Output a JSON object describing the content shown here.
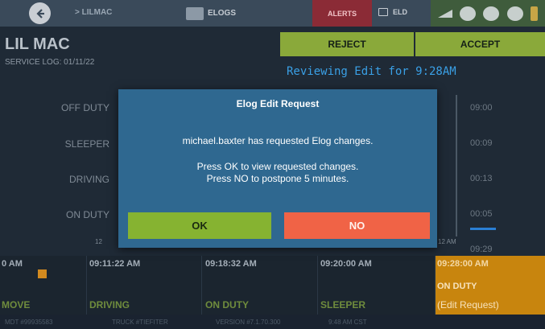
{
  "topbar": {
    "back_icon": "back-arrow-icon",
    "vehicle": "> LILMAC",
    "elogs_tab": "ELOGS",
    "alerts_tab": "ALERTS",
    "eld_tab": "ELD",
    "status_icons": [
      "signal-icon",
      "globe-icon",
      "truck-icon",
      "gauge-icon",
      "battery-icon"
    ]
  },
  "header": {
    "title": "LIL MAC",
    "service_log": "SERVICE LOG: 01/11/22",
    "reject_label": "REJECT",
    "accept_label": "ACCEPT",
    "reviewing": "Reviewing Edit for 9:28AM"
  },
  "grid": {
    "rows": [
      {
        "label": "OFF DUTY",
        "total": "09:00"
      },
      {
        "label": "SLEEPER",
        "total": "00:09"
      },
      {
        "label": "DRIVING",
        "total": "00:13"
      },
      {
        "label": "ON DUTY",
        "total": "00:05"
      }
    ],
    "axis_start": "12",
    "axis_end": "12 AM",
    "grand_total": "09:29"
  },
  "timeline": [
    {
      "time": "0 AM",
      "status": "MOVE"
    },
    {
      "time": "09:11:22 AM",
      "status": "DRIVING"
    },
    {
      "time": "09:18:32 AM",
      "status": "ON DUTY"
    },
    {
      "time": "09:20:00 AM",
      "status": "SLEEPER"
    }
  ],
  "edit_entry": {
    "time": "09:28:00 AM",
    "status": "ON DUTY",
    "note": "(Edit Request)"
  },
  "footer": {
    "mdt": "MDT #99935583",
    "truck": "TRUCK #TIEFITER",
    "version": "VERSION #7.1.70.300",
    "time": "9:48 AM CST"
  },
  "dialog": {
    "title": "Elog Edit Request",
    "message": "michael.baxter has requested Elog changes.",
    "line1": "Press OK to view requested changes.",
    "line2": "Press NO to postpone 5 minutes.",
    "ok_label": "OK",
    "no_label": "NO"
  },
  "colors": {
    "accent_green": "#86b331",
    "reject_accept_green": "#8aa93a",
    "no_red": "#f06346",
    "dialog_blue": "#2f6890",
    "reviewing_blue": "#3aa0e6",
    "edit_orange": "#c8850e",
    "alerts_red": "#8b2b36"
  }
}
